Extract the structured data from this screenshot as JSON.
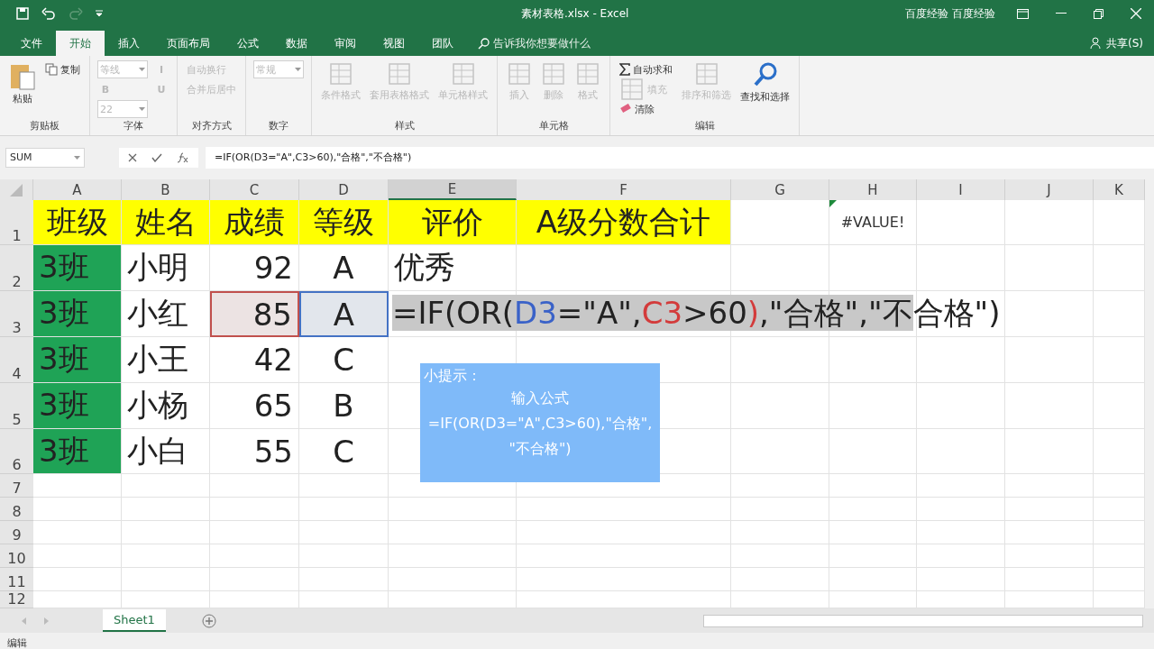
{
  "window": {
    "title": "素材表格.xlsx  -  Excel",
    "user": "百度经验 百度经验"
  },
  "quick_access": [
    {
      "kind": "save",
      "disabled": false
    },
    {
      "kind": "undo",
      "disabled": false
    },
    {
      "kind": "redo",
      "disabled": true
    }
  ],
  "tabs": [
    {
      "label": "文件",
      "selected": false
    },
    {
      "label": "开始",
      "selected": true
    },
    {
      "label": "插入",
      "selected": false
    },
    {
      "label": "页面布局",
      "selected": false
    },
    {
      "label": "公式",
      "selected": false
    },
    {
      "label": "数据",
      "selected": false
    },
    {
      "label": "审阅",
      "selected": false
    },
    {
      "label": "视图",
      "selected": false
    },
    {
      "label": "团队",
      "selected": false
    }
  ],
  "tell_me": {
    "placeholder": "告诉我你想要做什么"
  },
  "share": "共享(S)",
  "ribbon": [
    {
      "label": "剪贴板",
      "items": [
        {
          "label": "粘贴",
          "kind": "large",
          "disabled": false
        },
        {
          "label": "复制",
          "kind": "small",
          "disabled": false
        }
      ]
    },
    {
      "label": "字体",
      "items": [
        {
          "label": "等线",
          "kind": "combo",
          "disabled": true
        },
        {
          "label": "B",
          "kind": "glyph",
          "disabled": true
        },
        {
          "label": "22",
          "kind": "combo",
          "disabled": true
        },
        {
          "label": "I",
          "kind": "glyph",
          "disabled": true
        },
        {
          "label": "U",
          "kind": "glyph",
          "disabled": true
        }
      ]
    },
    {
      "label": "对齐方式",
      "items": [
        {
          "label": "自动换行",
          "kind": "small",
          "disabled": true
        },
        {
          "label": "合并后居中",
          "kind": "small",
          "disabled": true
        }
      ]
    },
    {
      "label": "数字",
      "items": [
        {
          "label": "常规",
          "kind": "combo",
          "disabled": true
        }
      ]
    },
    {
      "label": "样式",
      "items": [
        {
          "label": "条件格式",
          "kind": "large",
          "disabled": true
        },
        {
          "label": "套用表格格式",
          "kind": "large",
          "disabled": true
        },
        {
          "label": "单元格样式",
          "kind": "large",
          "disabled": true
        }
      ]
    },
    {
      "label": "单元格",
      "items": [
        {
          "label": "插入",
          "kind": "large",
          "disabled": true
        },
        {
          "label": "删除",
          "kind": "large",
          "disabled": true
        },
        {
          "label": "格式",
          "kind": "large",
          "disabled": true
        }
      ]
    },
    {
      "label": "编辑",
      "items": [
        {
          "label": "自动求和",
          "kind": "small",
          "disabled": false
        },
        {
          "label": "填充",
          "kind": "small",
          "disabled": true
        },
        {
          "label": "清除",
          "kind": "small",
          "disabled": false
        },
        {
          "label": "排序和筛选",
          "kind": "large",
          "disabled": true
        },
        {
          "label": "查找和选择",
          "kind": "large",
          "disabled": false
        }
      ]
    }
  ],
  "formula_bar": {
    "name_box": "SUM",
    "formula": "=IF(OR(D3=\"A\",C3>60),\"合格\",\"不合格\")"
  },
  "columns": [
    "A",
    "B",
    "C",
    "D",
    "E",
    "F",
    "G",
    "H",
    "I",
    "J",
    "K"
  ],
  "rows": [
    {
      "header": "1",
      "cells": [
        {
          "value": "班级",
          "color": "#ffff00"
        },
        {
          "value": "姓名",
          "color": "#ffff00"
        },
        {
          "value": "成绩",
          "color": "#ffff00"
        },
        {
          "value": "等级",
          "color": "#ffff00"
        },
        {
          "value": "评价",
          "color": "#ffff00"
        },
        {
          "value": "A级分数合计",
          "color": "#ffff00"
        },
        {},
        {
          "value": "#VALUE!",
          "kind": "error"
        }
      ]
    },
    {
      "header": "2",
      "cells": [
        {
          "value": "3班",
          "color": "#1fa356"
        },
        {
          "value": "小明"
        },
        {
          "value": "92"
        },
        {
          "value": "A"
        },
        {
          "value": "优秀",
          "kind": "left"
        }
      ]
    },
    {
      "header": "3",
      "cells": [
        {
          "value": "3班",
          "color": "#1fa356"
        },
        {
          "value": "小红"
        },
        {
          "value": "85",
          "kind": "ref",
          "color": "#c0504d"
        },
        {
          "value": "A",
          "kind": "ref",
          "color": "#4472c4"
        },
        {
          "kind": "editing",
          "parts": [
            {
              "text": "=IF(OR(",
              "selected": true
            },
            {
              "text": "D3",
              "selected": true,
              "color": "#3a62c8"
            },
            {
              "text": "=\"A\",",
              "selected": true
            },
            {
              "text": "C3",
              "selected": true,
              "color": "#d33b3b"
            },
            {
              "text": ">60",
              "selected": true
            },
            {
              "text": ")",
              "selected": true,
              "color": "#d33b3b"
            },
            {
              "text": ",\"合格\",\"不",
              "selected": true
            },
            {
              "text": "合格\")",
              "selected": false
            }
          ]
        }
      ]
    },
    {
      "header": "4",
      "cells": [
        {
          "value": "3班",
          "color": "#1fa356"
        },
        {
          "value": "小王"
        },
        {
          "value": "42"
        },
        {
          "value": "C"
        }
      ]
    },
    {
      "header": "5",
      "cells": [
        {
          "value": "3班",
          "color": "#1fa356"
        },
        {
          "value": "小杨"
        },
        {
          "value": "65"
        },
        {
          "value": "B"
        }
      ]
    },
    {
      "header": "6",
      "cells": [
        {
          "value": "3班",
          "color": "#1fa356"
        },
        {
          "value": "小白"
        },
        {
          "value": "55"
        },
        {
          "value": "C"
        }
      ]
    },
    {
      "header": "7",
      "cells": []
    },
    {
      "header": "8",
      "cells": []
    },
    {
      "header": "9",
      "cells": []
    },
    {
      "header": "10",
      "cells": []
    },
    {
      "header": "11",
      "cells": []
    },
    {
      "header": "12",
      "cells": []
    }
  ],
  "tip": {
    "title": "小提示：",
    "lines": [
      "输入公式",
      "=IF(OR(D3=\"A\",C3>60),\"合格\",",
      "\"不合格\")"
    ]
  },
  "sheets": [
    {
      "label": "Sheet1",
      "selected": true
    }
  ],
  "status_bar": "编辑"
}
